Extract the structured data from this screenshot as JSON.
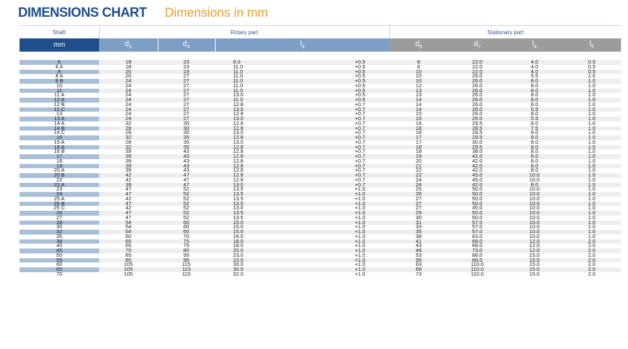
{
  "title": "DIMENSIONS CHART",
  "subtitle": "Dimensions in mm",
  "groups": {
    "shaft": "Shaft",
    "rotary": "Rotary part",
    "stationary": "Stationary part"
  },
  "unit_label": "mm",
  "columns": {
    "d3": {
      "base": "d",
      "sub": "3"
    },
    "d4": {
      "base": "d",
      "sub": "4"
    },
    "l3": {
      "base": "l",
      "sub": "3"
    },
    "d6": {
      "base": "d",
      "sub": "6"
    },
    "d7": {
      "base": "d",
      "sub": "7"
    },
    "l4": {
      "base": "l",
      "sub": "4"
    },
    "l5": {
      "base": "l",
      "sub": "5"
    },
    "l6": {
      "base": "l",
      "sub": "6"
    }
  },
  "rows": [
    [
      "6",
      "18",
      "23",
      "8.0",
      "+0.5",
      "8",
      "22.0",
      "4.0",
      "0.5",
      "3.5"
    ],
    [
      "6 A",
      "18",
      "23",
      "11.0",
      "+0.5",
      "8",
      "22.0",
      "4.0",
      "0.5",
      "3.5"
    ],
    [
      "8",
      "20",
      "23",
      "11.0",
      "+0.5",
      "10",
      "22.0",
      "4.0",
      "0.5",
      "3.5"
    ],
    [
      "8 A",
      "20",
      "27",
      "11.0",
      "+0.5",
      "10",
      "26.0",
      "5.5",
      "1.0",
      "5.0"
    ],
    [
      "8 B",
      "24",
      "27",
      "11.0",
      "+0.5",
      "10",
      "26.0",
      "8.0",
      "1.0",
      "6.0"
    ],
    [
      "10",
      "24",
      "27",
      "11.0",
      "+0.5",
      "12",
      "26.0",
      "8.0",
      "1.0",
      "6.0"
    ],
    [
      "11",
      "24",
      "27",
      "11.0",
      "+0.5",
      "13",
      "26.0",
      "8.0",
      "1.0",
      "6.0"
    ],
    [
      "11 A",
      "24",
      "27",
      "13.0",
      "+0.5",
      "13",
      "26.0",
      "8.0",
      "1.0",
      "6.0"
    ],
    [
      "12 A",
      "24",
      "27",
      "11.0",
      "+0.5",
      "14",
      "26.0",
      "8.0",
      "1.0",
      "6.0"
    ],
    [
      "12 B",
      "24",
      "27",
      "12.8",
      "+0.7",
      "14",
      "26.0",
      "8.0",
      "1.0",
      "6.0"
    ],
    [
      "12 C",
      "24",
      "27",
      "13.0",
      "+0.7",
      "14",
      "26.0",
      "5.5",
      "1.0",
      "6.0"
    ],
    [
      "13",
      "24",
      "27",
      "12.8",
      "+0.7",
      "15",
      "26.0",
      "8.0",
      "1.0",
      "6.0"
    ],
    [
      "13 A",
      "24",
      "27",
      "13.0",
      "+0.7",
      "15",
      "26.0",
      "5.5",
      "1.0",
      "6.0"
    ],
    [
      "14 A",
      "32",
      "35",
      "12.8",
      "+0.7",
      "16",
      "29.5",
      "8.0",
      "1.0",
      "6.0"
    ],
    [
      "14 B",
      "28",
      "30",
      "12.8",
      "+0.7",
      "18",
      "28.5",
      "7.5",
      "1.0",
      "5.5"
    ],
    [
      "14 C",
      "28",
      "30",
      "13.0",
      "+0.7",
      "18",
      "28.5",
      "8.0",
      "1.0",
      "5.5"
    ],
    [
      "15",
      "32",
      "35",
      "12.8",
      "+0.7",
      "17",
      "29.5",
      "8.0",
      "1.0",
      "6.0"
    ],
    [
      "15 A",
      "28",
      "35",
      "13.0",
      "+0.7",
      "17",
      "30.0",
      "8.0",
      "1.0",
      "6.0"
    ],
    [
      "16 A",
      "32",
      "35",
      "12.8",
      "+0.7",
      "18",
      "29.5",
      "8.0",
      "1.0",
      "6.0"
    ],
    [
      "16 B",
      "39",
      "43",
      "12.8",
      "+0.7",
      "18",
      "38.0",
      "8.0",
      "1.0",
      "6.0"
    ],
    [
      "17",
      "39",
      "43",
      "12.8",
      "+0.7",
      "19",
      "42.0",
      "8.0",
      "1.0",
      "6.0"
    ],
    [
      "18",
      "39",
      "43",
      "12.8",
      "+0.7",
      "20",
      "42.0",
      "8.0",
      "1.0",
      "6.0"
    ],
    [
      "19",
      "39",
      "43",
      "12.8",
      "+0.7",
      "21",
      "42.0",
      "8.0",
      "1.0",
      "6.0"
    ],
    [
      "20 A",
      "39",
      "43",
      "12.8",
      "+0.7",
      "22",
      "42.0",
      "8.0",
      "1.0",
      "6.0"
    ],
    [
      "20 B",
      "42",
      "47",
      "12.8",
      "+0.7",
      "22",
      "45.0",
      "10.0",
      "1.0",
      "8.0"
    ],
    [
      "22",
      "42",
      "47",
      "12.8",
      "+0.7",
      "24",
      "45.0",
      "10.0",
      "1.0",
      "8.0"
    ],
    [
      "22 A",
      "39",
      "47",
      "13.0",
      "+0.7",
      "24",
      "42.0",
      "8.0",
      "1.0",
      "8.0"
    ],
    [
      "23",
      "47",
      "52",
      "13.5",
      "+1.0",
      "25",
      "50.0",
      "10.0",
      "1.0",
      "8.0"
    ],
    [
      "24",
      "47",
      "52",
      "13.5",
      "+1.0",
      "26",
      "50.0",
      "10.0",
      "1.0",
      "8.0"
    ],
    [
      "25 A",
      "42",
      "52",
      "13.5",
      "+1.0",
      "27",
      "50.0",
      "10.0",
      "1.0",
      "8.0"
    ],
    [
      "25 B",
      "47",
      "52",
      "13.5",
      "+1.0",
      "27",
      "50.0",
      "10.0",
      "1.0",
      "8.0"
    ],
    [
      "25 C",
      "42",
      "52",
      "13.0",
      "+1.0",
      "27",
      "45.0",
      "10.0",
      "1.0",
      "8.0"
    ],
    [
      "26",
      "47",
      "52",
      "13.5",
      "+1.0",
      "29",
      "50.0",
      "10.0",
      "1.0",
      "8.0"
    ],
    [
      "27",
      "47",
      "52",
      "13.5",
      "+1.0",
      "30",
      "50.0",
      "10.0",
      "1.0",
      "8.0"
    ],
    [
      "28",
      "54",
      "60",
      "15.0",
      "+1.0",
      "31",
      "57.0",
      "10.0",
      "1.0",
      "8.0"
    ],
    [
      "30",
      "54",
      "60",
      "15.0",
      "+1.0",
      "33",
      "57.0",
      "10.0",
      "1.0",
      "8.0"
    ],
    [
      "32",
      "54",
      "60",
      "15.0",
      "+1.0",
      "35",
      "57.0",
      "10.0",
      "1.0",
      "8.0"
    ],
    [
      "35",
      "60",
      "70",
      "16.0",
      "+1.0",
      "38",
      "63.0",
      "10.0",
      "1.0",
      "8.0"
    ],
    [
      "38",
      "65",
      "75",
      "18.0",
      "+1.0",
      "41",
      "68.0",
      "12.0",
      "2.0",
      "9.0"
    ],
    [
      "40",
      "65",
      "75",
      "18.0",
      "+1.0",
      "43",
      "68.0",
      "12.0",
      "2.0",
      "9.0"
    ],
    [
      "45",
      "70",
      "80",
      "20.0",
      "+1.0",
      "48",
      "73.0",
      "12.0",
      "2.0",
      "9.0"
    ],
    [
      "50",
      "85",
      "95",
      "23.0",
      "+1.0",
      "53",
      "88.0",
      "15.0",
      "2.0",
      "12.0"
    ],
    [
      "55",
      "85",
      "95",
      "23.0",
      "+1.0",
      "95",
      "88.0",
      "15.0",
      "2.0",
      "12.0"
    ],
    [
      "60",
      "105",
      "115",
      "30.0",
      "+1.0",
      "63",
      "110.0",
      "15.0",
      "2.0",
      "12.0"
    ],
    [
      "65",
      "105",
      "115",
      "30.0",
      "+1.0",
      "68",
      "110.0",
      "15.0",
      "2.0",
      "12.0"
    ],
    [
      "70",
      "105",
      "115",
      "32.0",
      "+1.0",
      "73",
      "110.0",
      "15.0",
      "2.0",
      "12.0"
    ]
  ]
}
